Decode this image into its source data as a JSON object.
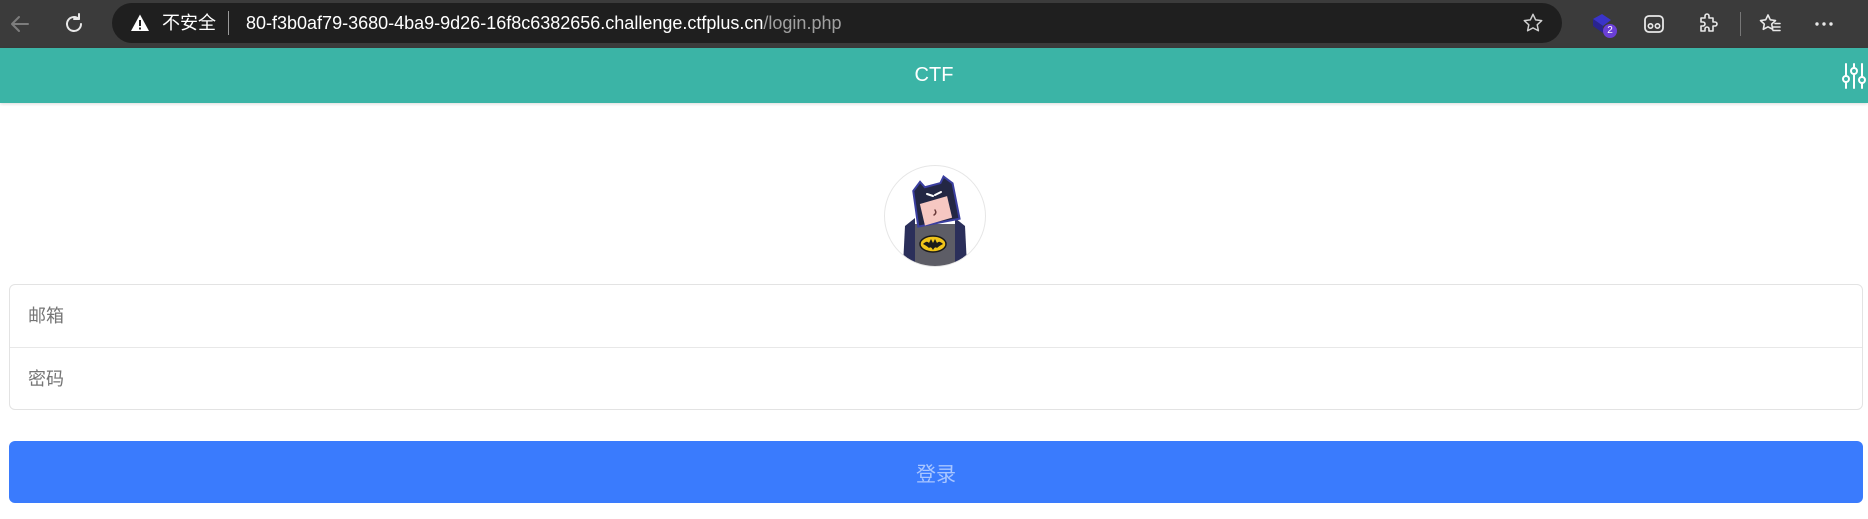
{
  "browser": {
    "insecure_label": "不安全",
    "url_host": "80-f3b0af79-3680-4ba9-9d26-16f8c6382656.challenge.ctfplus.cn",
    "url_path": "/login.php",
    "extension_badge_count": "2",
    "icons": [
      "back-arrow-icon",
      "refresh-icon",
      "warning-icon",
      "star-icon",
      "extension-icon",
      "profile-mask-icon",
      "puzzle-icon",
      "favorites-icon",
      "more-icon"
    ]
  },
  "header": {
    "title": "CTF",
    "background_color": "#3bb4a6",
    "settings_icon": "sliders-icon"
  },
  "avatar": {
    "icon": "batman-avatar"
  },
  "form": {
    "email_placeholder": "邮箱",
    "password_placeholder": "密码",
    "email_value": "",
    "password_value": ""
  },
  "login_button": {
    "label": "登录",
    "background_color": "#3a7bfd"
  }
}
